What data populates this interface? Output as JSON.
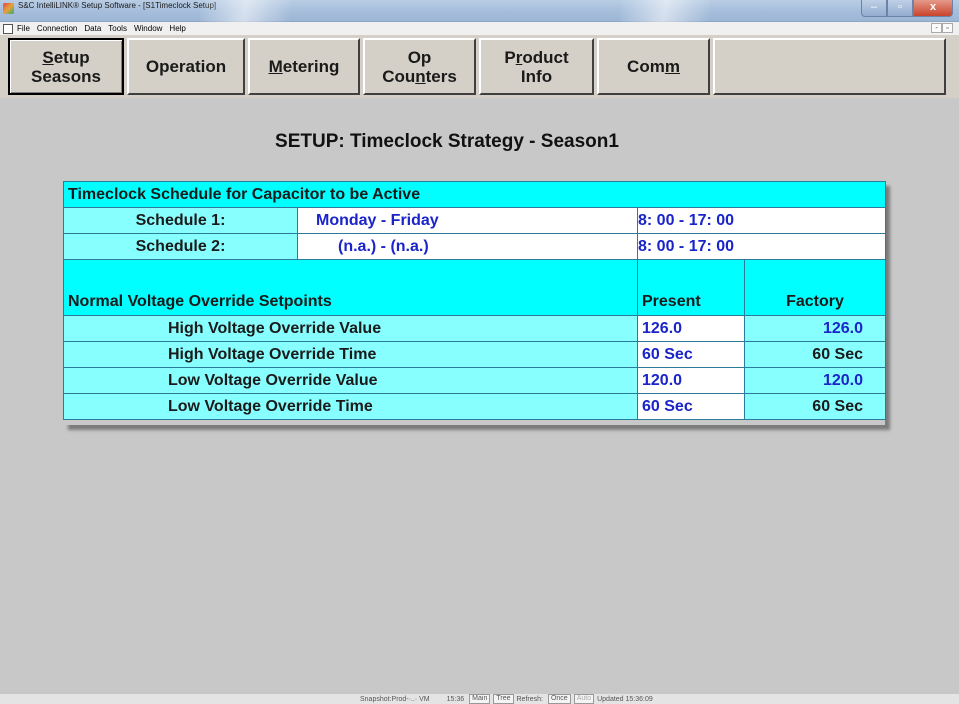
{
  "window": {
    "title": "S&C IntelliLINK® Setup Software - [S1Timeclock Setup]",
    "min_label": "–",
    "max_label": "▫",
    "close_label": "x"
  },
  "menu": {
    "items": [
      "File",
      "Connection",
      "Data",
      "Tools",
      "Window",
      "Help"
    ],
    "mdi_min": "-",
    "mdi_restore": "▫"
  },
  "tabs": [
    {
      "line1_ul": "S",
      "line1_rest": "etup",
      "line2": "Seasons"
    },
    {
      "label": "Operation"
    },
    {
      "ul": "M",
      "rest": "etering"
    },
    {
      "line1": "Op",
      "line2_pre": "Cou",
      "line2_ul": "n",
      "line2_post": "ters"
    },
    {
      "line1_pre": "P",
      "line1_ul": "r",
      "line1_post": "oduct",
      "line2": "Info"
    },
    {
      "pre": "Com",
      "ul": "m"
    },
    {
      "label": ""
    }
  ],
  "page": {
    "title": "SETUP: Timeclock Strategy - Season1"
  },
  "schedule": {
    "header": "Timeclock Schedule for Capacitor to be Active",
    "rows": [
      {
        "label": "Schedule 1:",
        "days": "Monday  -  Friday",
        "times": "8: 00  -  17: 00"
      },
      {
        "label": "Schedule 2:",
        "days": "(n.a.)  -  (n.a.)",
        "times": "8: 00  -  17: 00"
      }
    ]
  },
  "override": {
    "header": "Normal Voltage Override Setpoints",
    "col_present": "Present",
    "col_factory": "Factory",
    "rows": [
      {
        "label": "High Voltage Override Value",
        "present": "126.0",
        "factory": "126.0"
      },
      {
        "label": "High Voltage Override Time",
        "present": "60 Sec",
        "factory": "60 Sec"
      },
      {
        "label": "Low Voltage Override Value",
        "present": "120.0",
        "factory": "120.0"
      },
      {
        "label": "Low Voltage Override Time",
        "present": "60 Sec",
        "factory": "60 Sec"
      }
    ]
  },
  "status": {
    "snapshot": "Snapshot:Prod-·..· VM",
    "time": "15:36",
    "main": "Main",
    "tree": "Tree",
    "refresh": "Refresh:",
    "once": "Once",
    "auto": "Auto",
    "updated": "Updated 15:36:09"
  }
}
